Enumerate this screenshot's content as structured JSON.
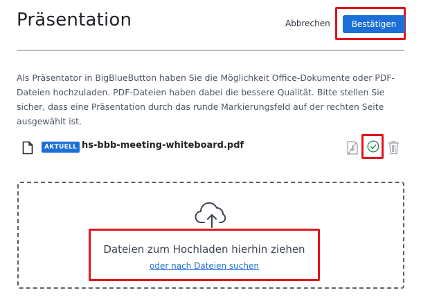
{
  "header": {
    "title": "Präsentation",
    "cancel_label": "Abbrechen",
    "confirm_label": "Bestätigen"
  },
  "description": "Als Präsentator in BigBlueButton haben Sie die Möglichkeit Office-Dokumente oder PDF-Dateien hochzuladen. PDF-Dateien haben dabei die bessere Qualität. Bitte stellen Sie sicher, dass eine Präsentation durch das runde Markierungsfeld auf der rechten Seite ausgewählt ist.",
  "files": [
    {
      "badge": "AKTUELL",
      "name": "hs-bbb-meeting-whiteboard.pdf",
      "icons": [
        "document-icon",
        "download-disabled-icon",
        "check-circle-icon",
        "trash-icon"
      ]
    }
  ],
  "dropzone": {
    "icon": "cloud-upload-icon",
    "text": "Dateien zum Hochladen hierhin ziehen",
    "link": "oder nach Dateien suchen"
  },
  "colors": {
    "primary": "#1b6fd6",
    "highlight": "#e0141e",
    "success": "#2a8a5a",
    "divider": "#b9bec5"
  }
}
